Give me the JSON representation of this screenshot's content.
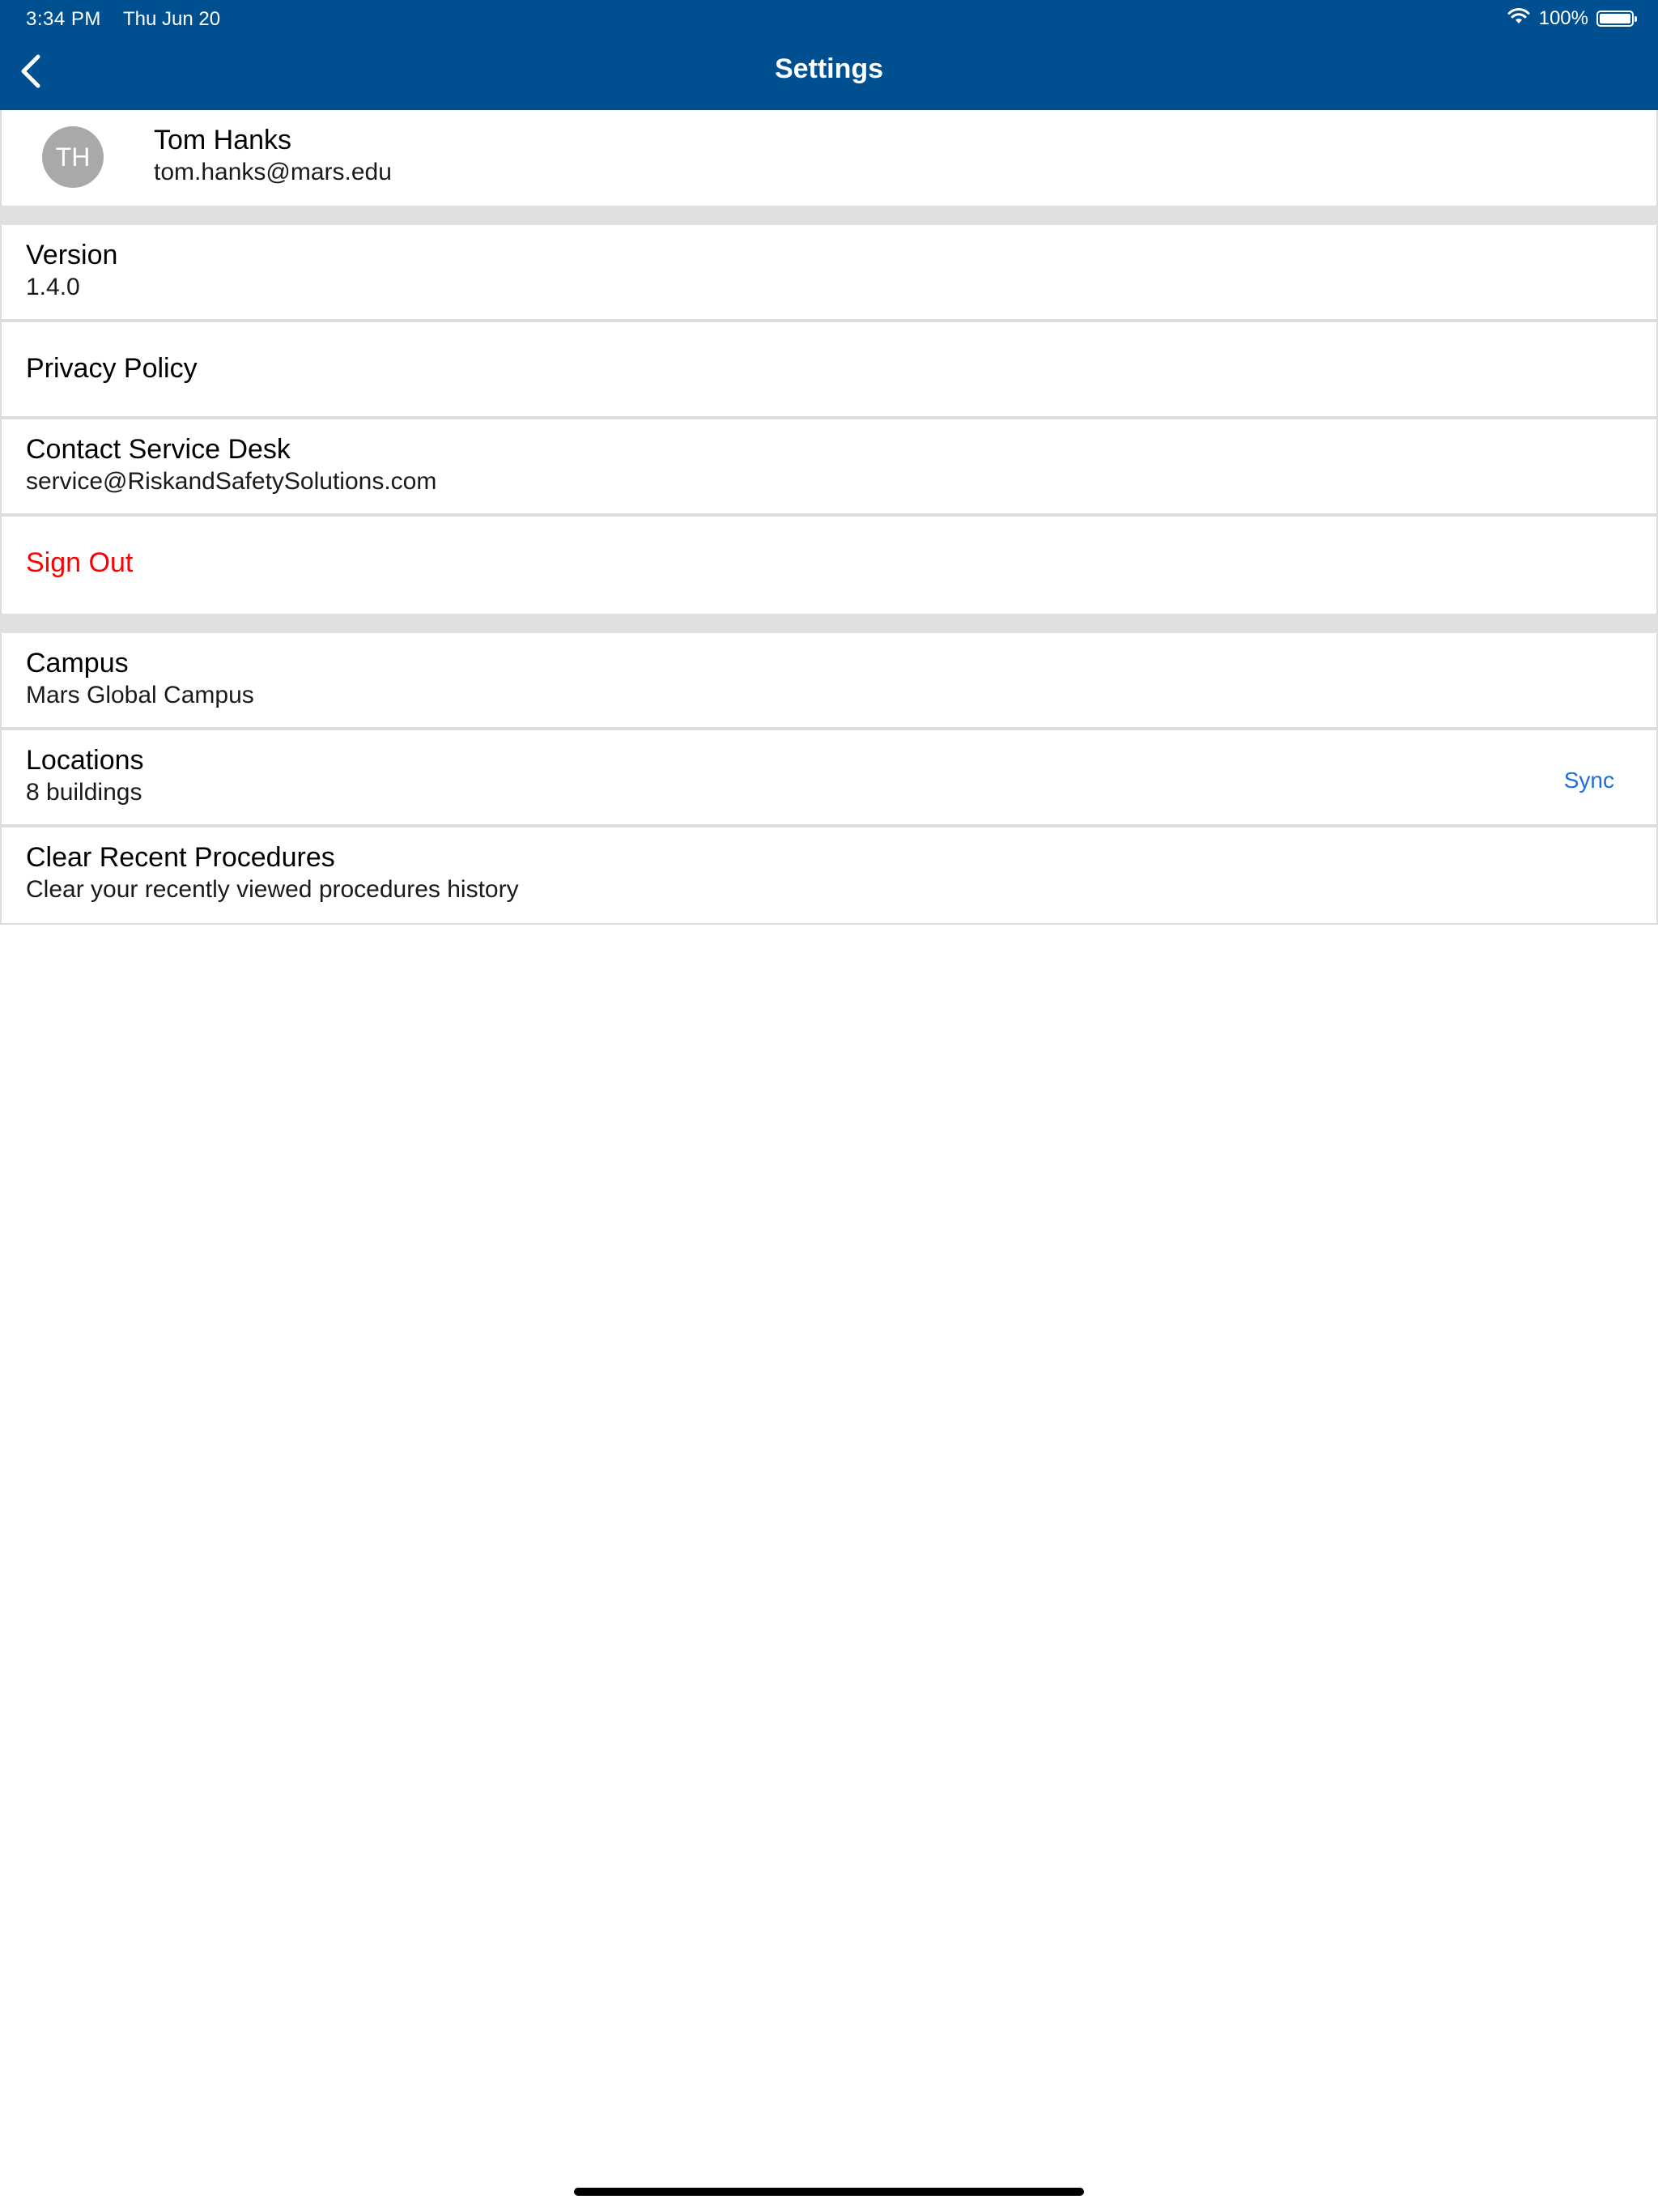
{
  "status_bar": {
    "time": "3:34 PM",
    "date": "Thu Jun 20",
    "battery": "100%",
    "wifi_icon": "wifi-icon",
    "battery_icon": "battery-icon"
  },
  "nav": {
    "title": "Settings",
    "back_icon": "chevron-left-icon"
  },
  "profile": {
    "initials": "TH",
    "name": "Tom Hanks",
    "email": "tom.hanks@mars.edu"
  },
  "app_section": {
    "version_label": "Version",
    "version_value": "1.4.0",
    "privacy_label": "Privacy Policy",
    "contact_label": "Contact Service Desk",
    "contact_email": "service@RiskandSafetySolutions.com",
    "signout_label": "Sign Out"
  },
  "data_section": {
    "campus_label": "Campus",
    "campus_value": "Mars Global Campus",
    "locations_label": "Locations",
    "locations_value": "8 buildings",
    "sync_label": "Sync",
    "clear_label": "Clear Recent Procedures",
    "clear_desc": "Clear your recently viewed procedures history"
  },
  "colors": {
    "header_bg": "#004f91",
    "signout": "#ff0000",
    "link": "#1b6fd6",
    "section_gap": "#e0e0e0",
    "avatar_bg": "#a9a9a9"
  }
}
